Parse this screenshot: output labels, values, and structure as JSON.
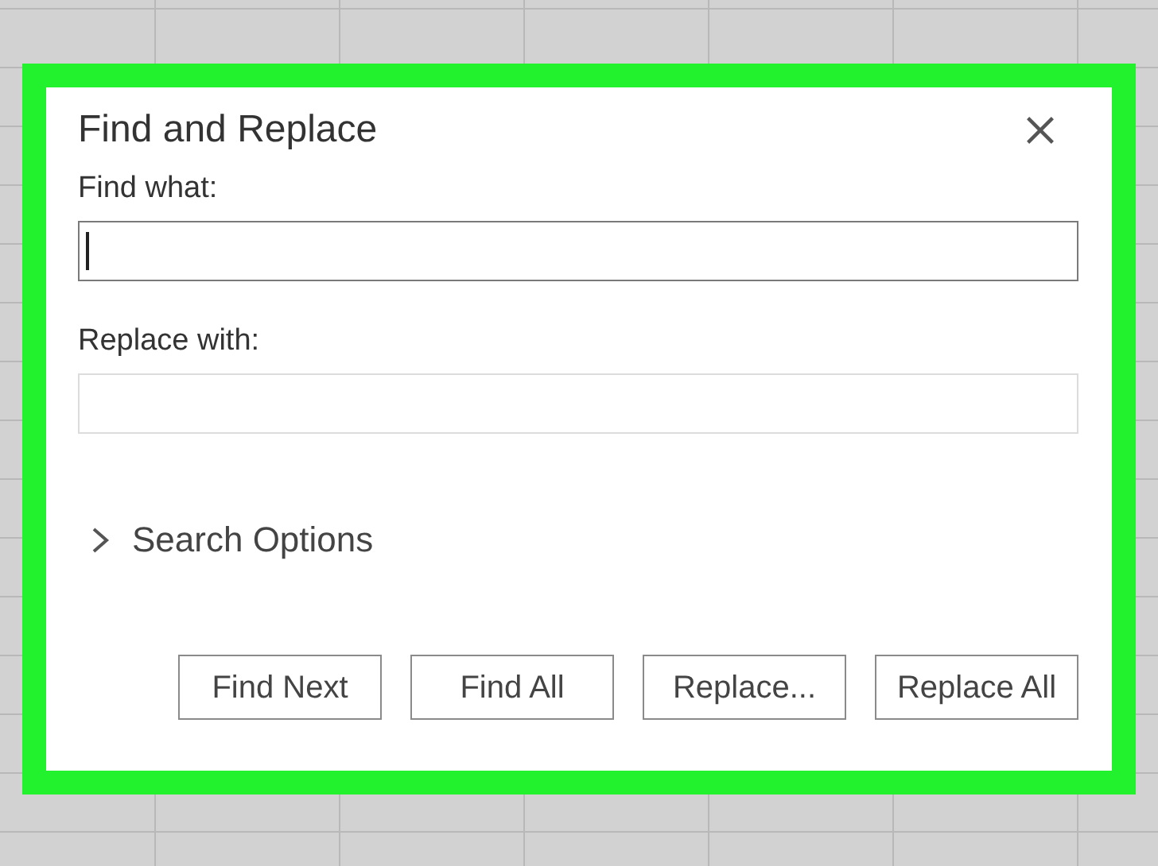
{
  "dialog": {
    "title": "Find and Replace",
    "fields": [
      {
        "label": "Find what:",
        "focused": true
      },
      {
        "label": "Replace with:",
        "focused": false
      }
    ],
    "search_options": {
      "label": "Search Options",
      "expanded": false
    },
    "buttons": [
      "Find Next",
      "Find All",
      "Replace...",
      "Replace All"
    ]
  }
}
